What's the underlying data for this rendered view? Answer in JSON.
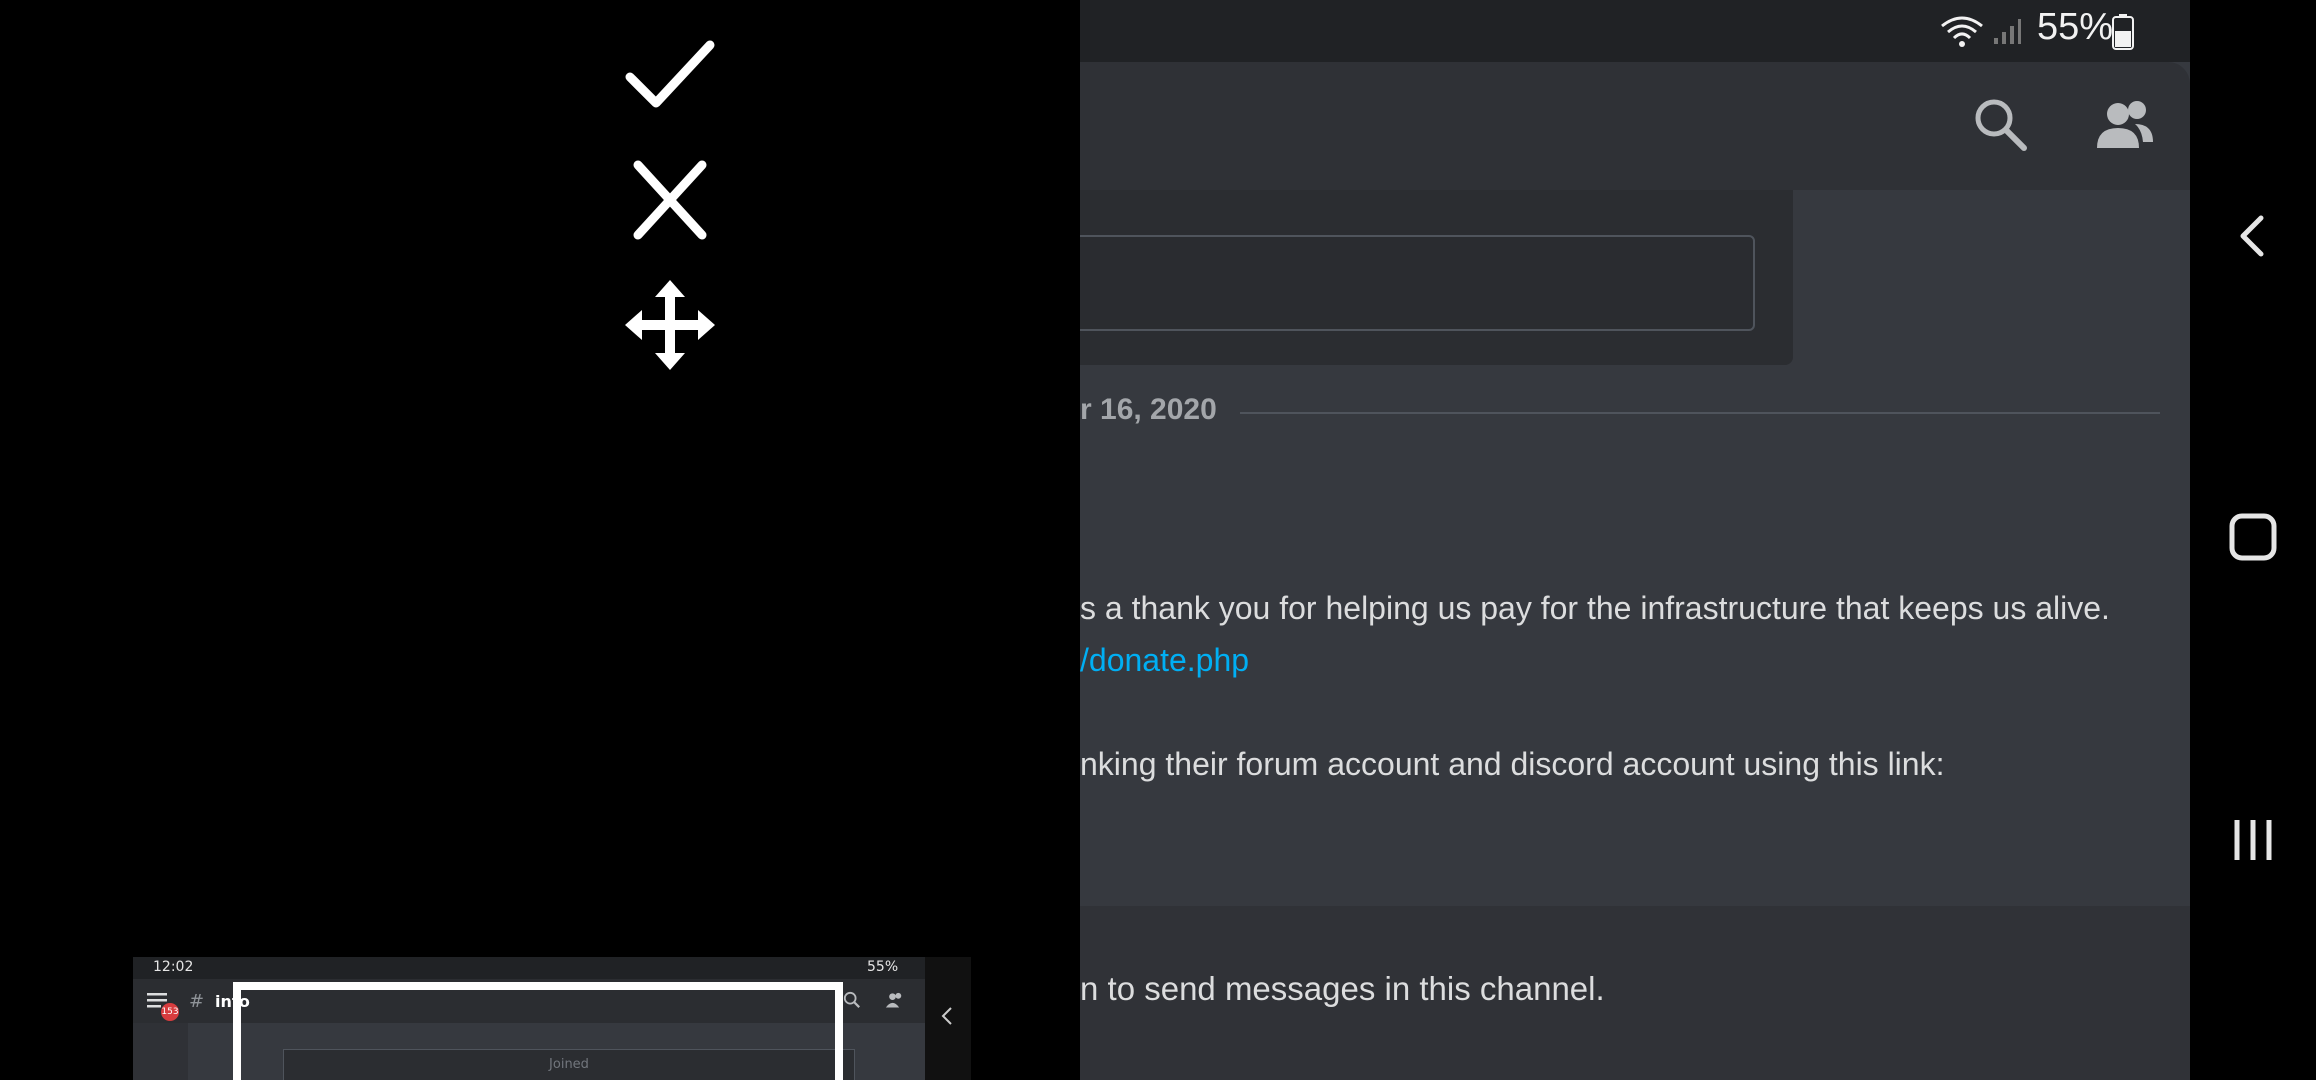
{
  "crop_tools": {
    "confirm_icon": "check-icon",
    "cancel_icon": "close-icon",
    "move_icon": "move-arrows-icon"
  },
  "mini_preview": {
    "time": "12:02",
    "battery": "55%",
    "channel": "info",
    "badge": "153",
    "joined_text": "Joined"
  },
  "status_bar": {
    "battery_percent": "55%"
  },
  "topbar": {
    "search_icon": "search-icon",
    "members_icon": "members-icon"
  },
  "chat": {
    "date_divider": "r 16, 2020",
    "messages": [
      "s a thank you for helping us pay for the infrastructure that keeps us alive.",
      "/donate.php",
      "nking their forum account and discord account using this link:"
    ],
    "no_permission": "n to send messages in this channel."
  },
  "colors": {
    "link": "#00aff4",
    "background": "#36393f",
    "badge": "#d83c3e"
  }
}
